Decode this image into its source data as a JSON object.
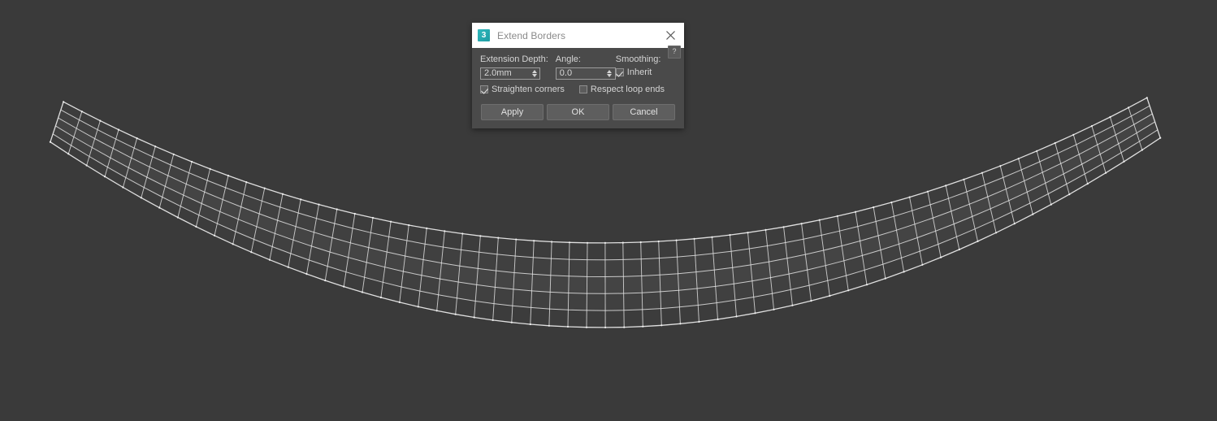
{
  "viewport": {
    "background_color": "#3a3a3a",
    "object_name": "curved-mesh-band",
    "wireframe_color": "#e8e8e8",
    "surface_color": "#404040"
  },
  "dialog": {
    "title": "Extend Borders",
    "icon_label": "3",
    "icon_name": "app-icon-3",
    "icon_color": "#2eb6bb",
    "titlebar_bg": "#ffffff",
    "body_bg": "#4a4a4a",
    "close_label": "✕",
    "help_label": "?",
    "fields": {
      "extension_depth": {
        "label": "Extension Depth:",
        "value": "2.0mm"
      },
      "angle": {
        "label": "Angle:",
        "value": "0.0"
      },
      "smoothing": {
        "label": "Smoothing:",
        "inherit_label": "Inherit",
        "inherit_checked": true
      }
    },
    "checkboxes": [
      {
        "label": "Straighten corners",
        "checked": true
      },
      {
        "label": "Respect loop ends",
        "checked": false
      }
    ],
    "buttons": [
      {
        "label": "Apply"
      },
      {
        "label": "OK"
      },
      {
        "label": "Cancel"
      }
    ]
  }
}
